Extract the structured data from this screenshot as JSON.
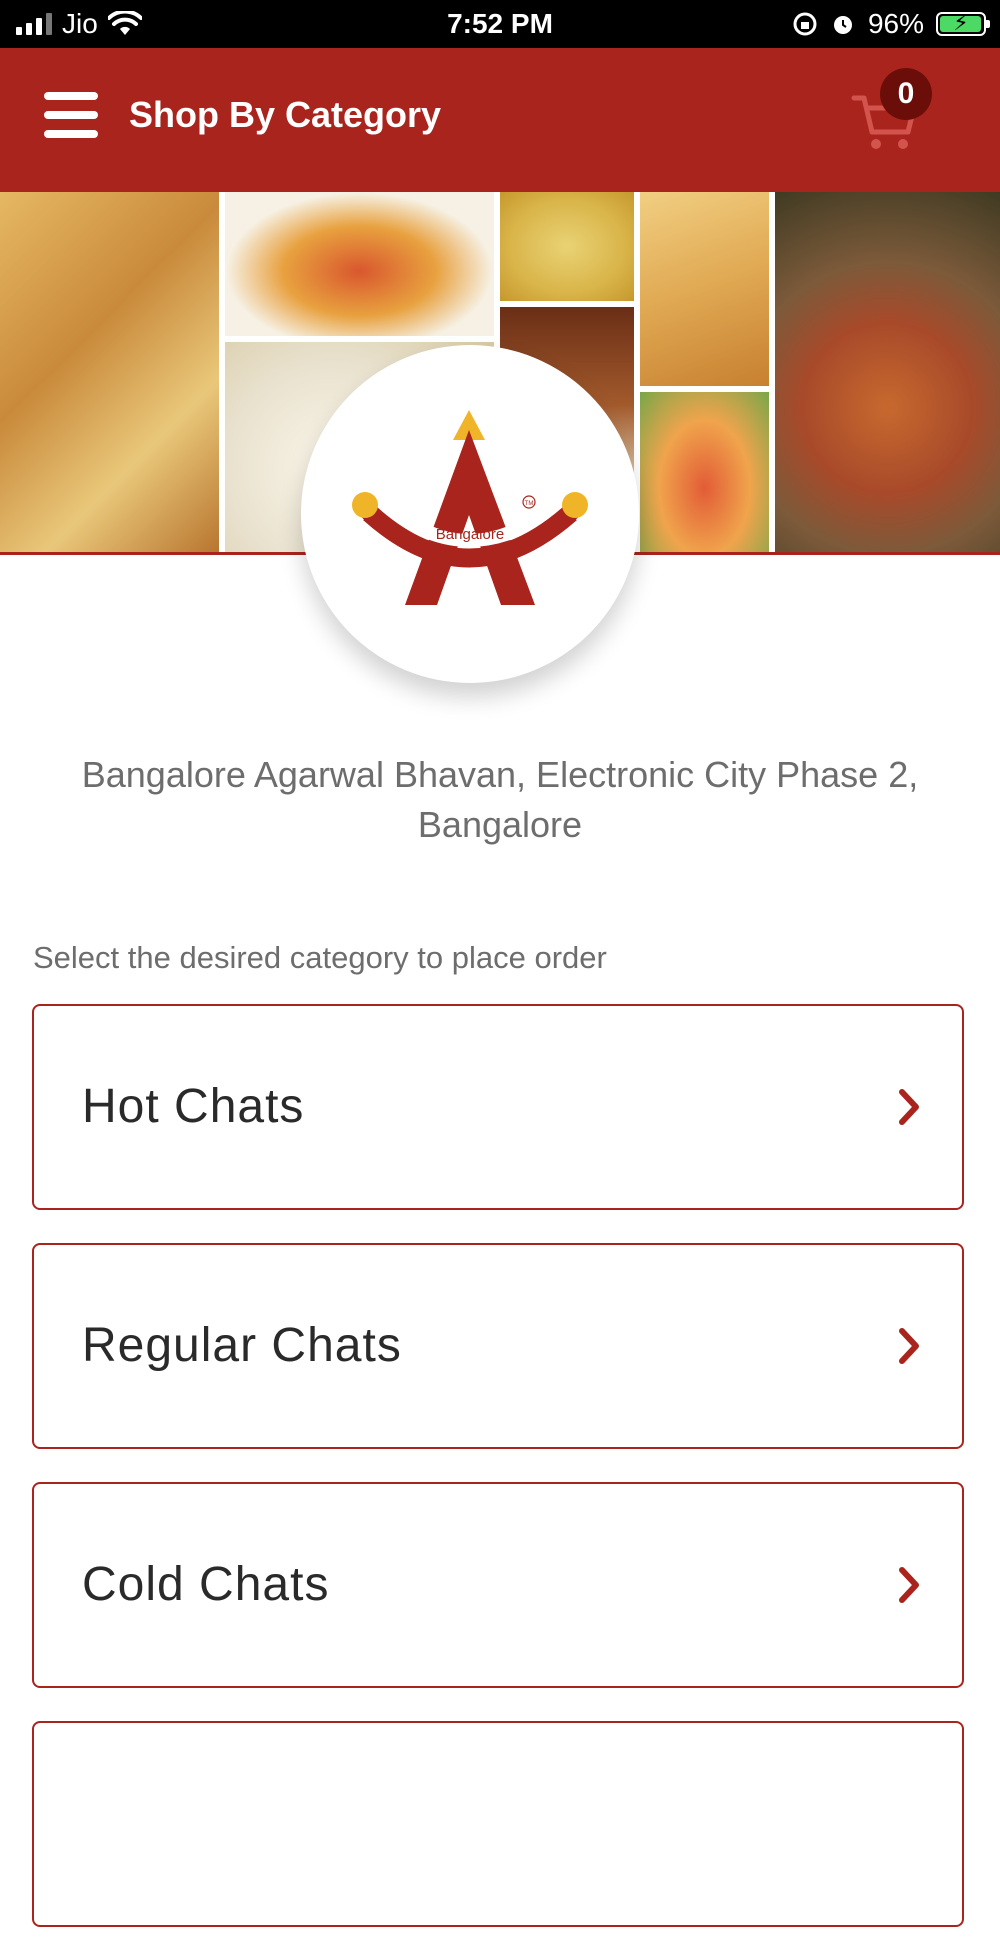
{
  "status_bar": {
    "carrier": "Jio",
    "time": "7:52 PM",
    "battery_percent": "96%"
  },
  "header": {
    "title": "Shop By Category",
    "cart_count": "0"
  },
  "logo": {
    "text": "Bangalore",
    "trademark": "TM"
  },
  "restaurant": {
    "name": "Bangalore Agarwal Bhavan, Electronic City Phase 2, Bangalore"
  },
  "instruction": "Select the desired category to place order",
  "categories": [
    {
      "label": "Hot Chats"
    },
    {
      "label": "Regular Chats"
    },
    {
      "label": "Cold Chats"
    },
    {
      "label": ""
    }
  ],
  "colors": {
    "brand_red": "#a9241c",
    "text_gray": "#6d6d6d"
  }
}
